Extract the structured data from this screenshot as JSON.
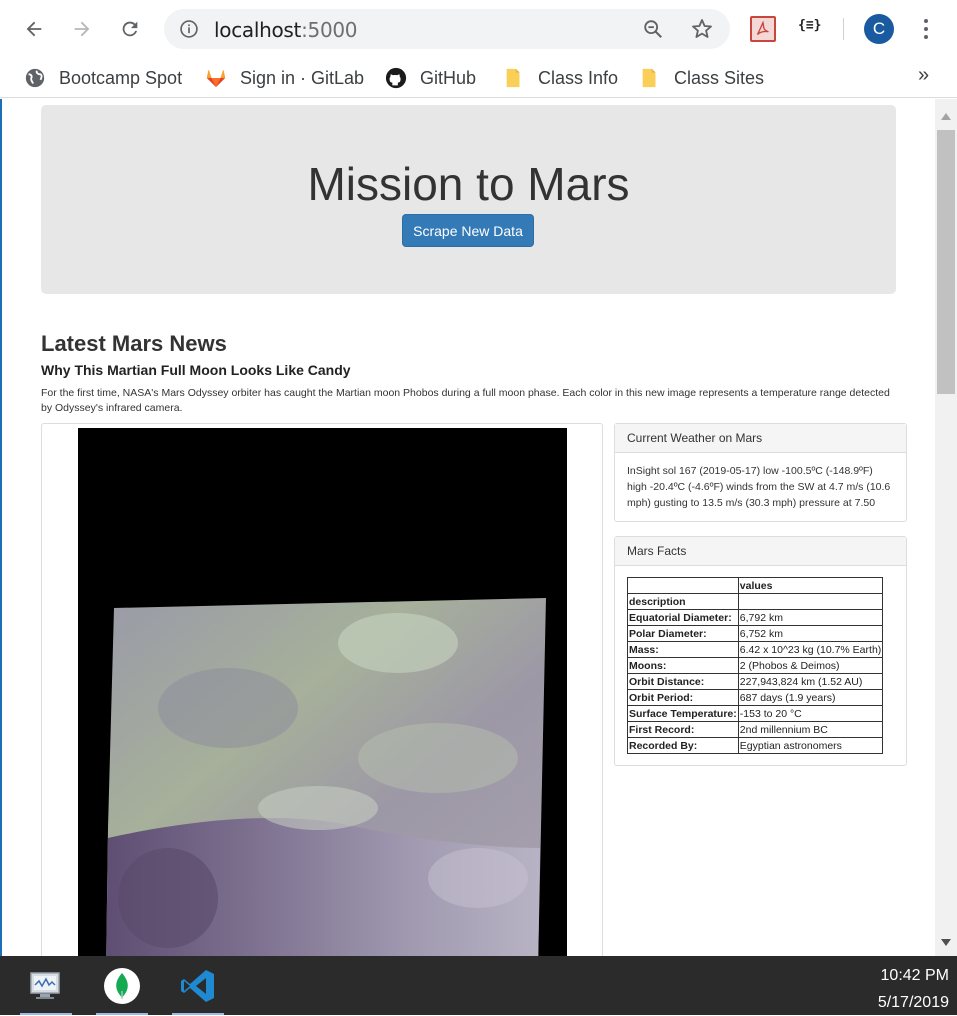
{
  "browser": {
    "url_host": "localhost",
    "url_port": ":5000",
    "profile_initial": "C",
    "json_ext_label": "{≡}",
    "bookmarks": [
      {
        "label": "Bootcamp Spot",
        "icon": "globe-icon"
      },
      {
        "label": "Sign in · GitLab",
        "icon": "gitlab-icon"
      },
      {
        "label": "GitHub",
        "icon": "github-icon"
      },
      {
        "label": "Class Info",
        "icon": "folder-icon"
      },
      {
        "label": "Class Sites",
        "icon": "folder-icon"
      }
    ],
    "bookmarks_more": "»"
  },
  "page": {
    "title": "Mission to Mars",
    "scrape_button": "Scrape New Data",
    "news_heading": "Latest Mars News",
    "news_title": "Why This Martian Full Moon Looks Like Candy",
    "news_paragraph": "For the first time, NASA's Mars Odyssey orbiter has caught the Martian moon Phobos during a full moon phase. Each color in this new image represents a temperature range detected by Odyssey's infrared camera.",
    "weather_heading": "Current Weather on Mars",
    "weather_text": "InSight sol 167 (2019-05-17) low -100.5ºC (-148.9ºF) high -20.4ºC (-4.6ºF) winds from the SW at 4.7 m/s (10.6 mph) gusting to 13.5 m/s (30.3 mph) pressure at 7.50",
    "facts_heading": "Mars Facts",
    "facts_table": {
      "col_header": "values",
      "index_header": "description",
      "rows": [
        {
          "key": "Equatorial Diameter:",
          "value": "6,792 km"
        },
        {
          "key": "Polar Diameter:",
          "value": "6,752 km"
        },
        {
          "key": "Mass:",
          "value": "6.42 x 10^23 kg (10.7% Earth)"
        },
        {
          "key": "Moons:",
          "value": "2 (Phobos & Deimos)"
        },
        {
          "key": "Orbit Distance:",
          "value": "227,943,824 km (1.52 AU)"
        },
        {
          "key": "Orbit Period:",
          "value": "687 days (1.9 years)"
        },
        {
          "key": "Surface Temperature:",
          "value": "-153 to 20 °C"
        },
        {
          "key": "First Record:",
          "value": "2nd millennium BC"
        },
        {
          "key": "Recorded By:",
          "value": "Egyptian astronomers"
        }
      ]
    }
  },
  "taskbar": {
    "time": "10:42 PM",
    "date": "5/17/2019",
    "apps": [
      "monitor-app-icon",
      "mongodb-compass-icon",
      "vscode-icon"
    ]
  },
  "colors": {
    "primary_button": "#337ab7",
    "jumbotron_bg": "#e7e7e7",
    "avatar_bg": "#1a5aa0",
    "taskbar_bg": "#2b2b2b"
  }
}
